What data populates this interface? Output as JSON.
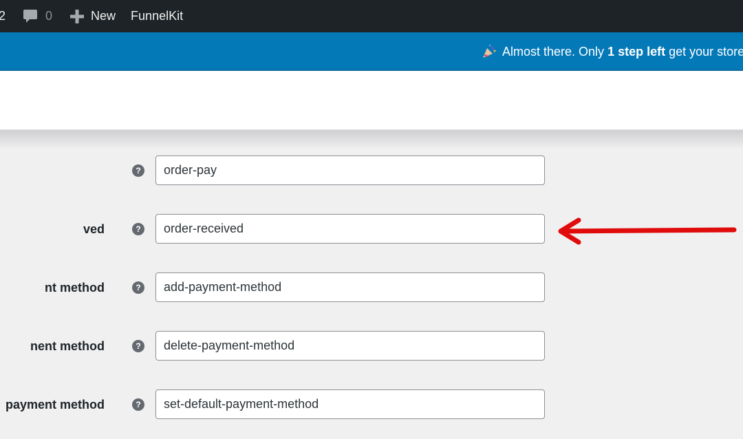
{
  "adminbar": {
    "updates_count": "2",
    "comments_count": "0",
    "new_label": "New",
    "funnelkit_label": "FunnelKit"
  },
  "notice": {
    "text_before": "Almost there. Only ",
    "text_bold": "1 step left",
    "text_after": " get your store"
  },
  "fields": [
    {
      "label": "",
      "value": "order-pay"
    },
    {
      "label": "ved",
      "value": "order-received"
    },
    {
      "label": "nt method",
      "value": "add-payment-method"
    },
    {
      "label": "nent method",
      "value": "delete-payment-method"
    },
    {
      "label": "payment method",
      "value": "set-default-payment-method"
    }
  ],
  "help_glyph": "?",
  "annotation": {
    "arrow_color": "#e00b0b",
    "points_to": "order-received"
  }
}
